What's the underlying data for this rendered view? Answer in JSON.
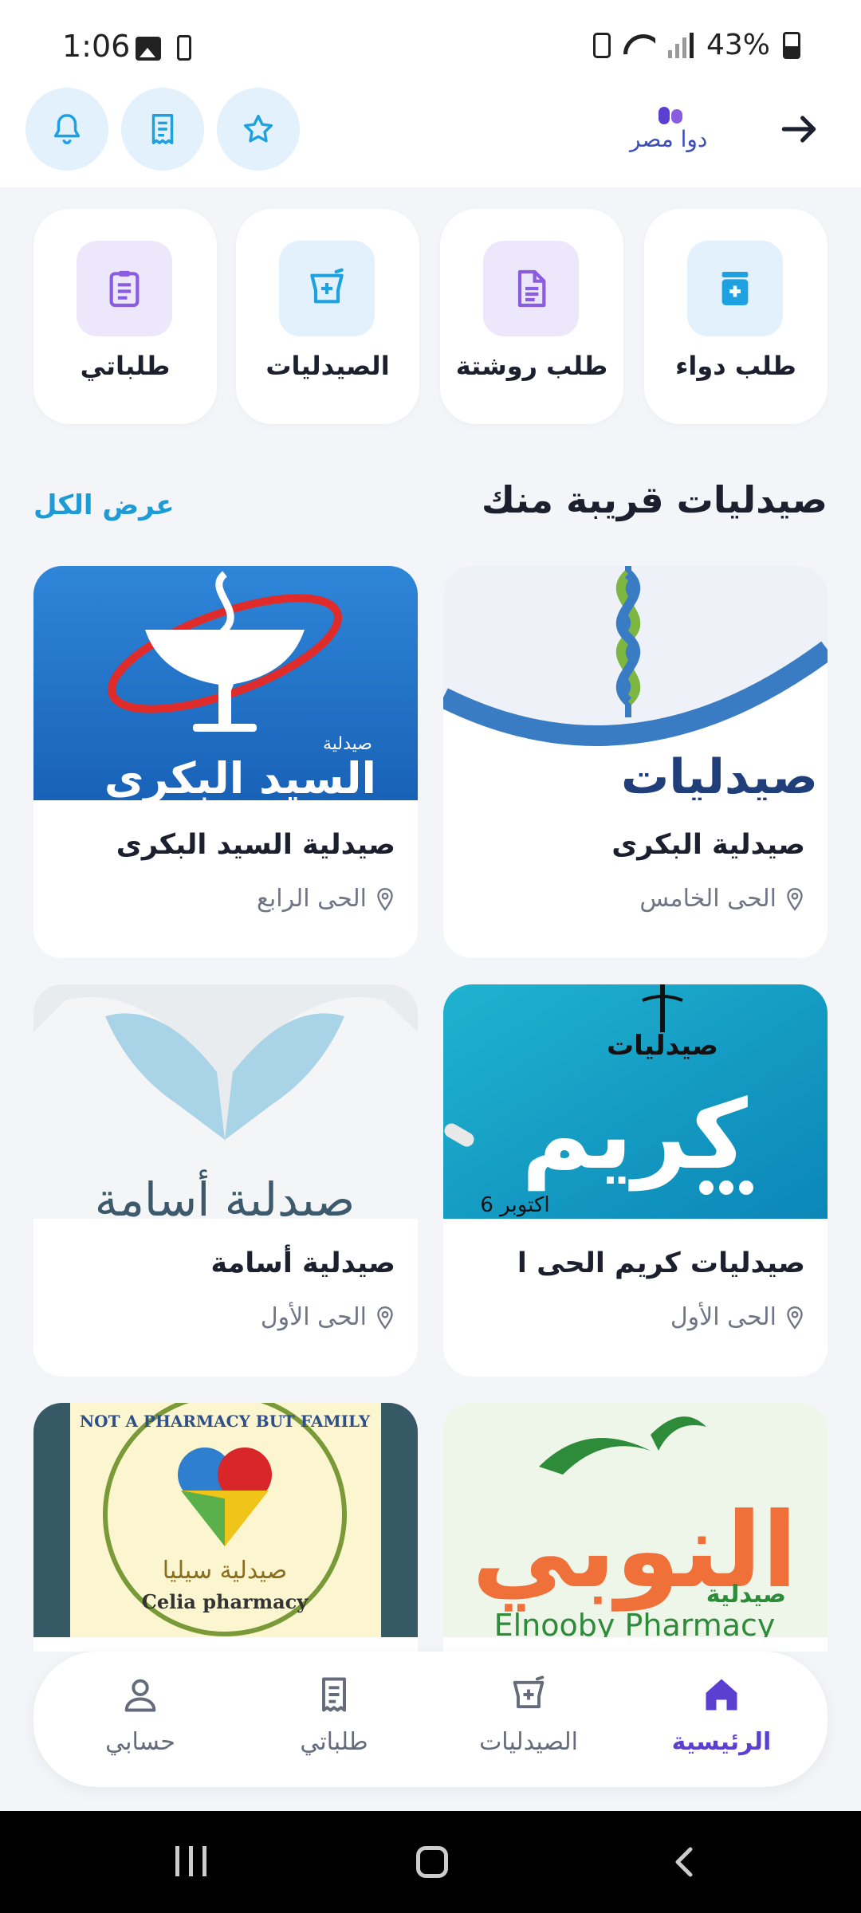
{
  "status_bar": {
    "time": "1:06",
    "battery": "43%"
  },
  "header": {
    "logo_text": "دوا مصر"
  },
  "quick_actions": [
    {
      "label": "طلب دواء",
      "icon": "medicine-box-icon"
    },
    {
      "label": "طلب روشتة",
      "icon": "document-icon"
    },
    {
      "label": "الصيدليات",
      "icon": "pharmacy-mortar-icon"
    },
    {
      "label": "طلباتي",
      "icon": "clipboard-icon"
    }
  ],
  "nearby": {
    "title": "صيدليات قريبة منك",
    "see_all": "عرض الكل"
  },
  "pharmacies": [
    {
      "name": "صيدلية البكرى",
      "location": "الحى الخامس",
      "banner_text": "صيدليات"
    },
    {
      "name": "صيدلية السيد البكرى",
      "location": "الحى الرابع",
      "banner_small": "صيدلية",
      "banner_text": "السيد البكري"
    },
    {
      "name": "صيدليات كريم الحى ا",
      "location": "الحى الأول",
      "banner_top": "صيدليات",
      "banner_text": "كريم",
      "banner_bottom": "6 اكتوبر"
    },
    {
      "name": "صيدلية أسامة",
      "location": "الحى الأول",
      "banner_text": "صيدلية أسامة"
    },
    {
      "name": "",
      "location": "",
      "banner_text": "النوبي",
      "banner_small": "صيدلية",
      "banner_bottom": "Elnooby Pharmacy"
    },
    {
      "name": "",
      "location": "",
      "banner_top": "NOT A PHARMACY BUT FAMILY",
      "banner_text": "صيدلية سيليا",
      "banner_bottom": "Celia pharmacy"
    }
  ],
  "bottom_nav": [
    {
      "label": "الرئيسية",
      "active": true
    },
    {
      "label": "الصيدليات",
      "active": false
    },
    {
      "label": "طلباتي",
      "active": false
    },
    {
      "label": "حسابي",
      "active": false
    }
  ],
  "colors": {
    "accent": "#5b3fd1",
    "link": "#1d9bd6",
    "icon_blue": "#1da1e0",
    "icon_purple": "#8a5ce0"
  }
}
